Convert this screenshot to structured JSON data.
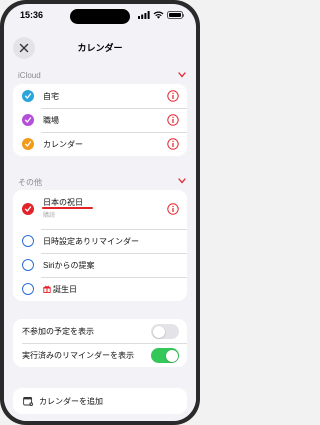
{
  "status_bar": {
    "time": "15:36",
    "icons": [
      "location-arrow-icon",
      "signal-bars-icon",
      "wifi-icon",
      "battery-icon"
    ]
  },
  "nav": {
    "close_icon": "close-icon",
    "title": "カレンダー"
  },
  "icloud_section": {
    "header": "iCloud",
    "items": [
      {
        "label": "自宅",
        "color": "#2aa5dc",
        "checked": true
      },
      {
        "label": "職場",
        "color": "#b44fd9",
        "checked": true
      },
      {
        "label": "カレンダー",
        "color": "#f29a1a",
        "checked": true
      }
    ]
  },
  "other_section": {
    "header": "その他",
    "items": [
      {
        "label": "日本の祝日",
        "sub": "購読",
        "color": "#e3232a",
        "checked": true,
        "has_info": true
      },
      {
        "label": "日時設定ありリマインダー",
        "checked": false
      },
      {
        "label": "Siriからの提案",
        "checked": false
      },
      {
        "label": "誕生日",
        "icon": "gift-icon",
        "checked": false
      }
    ]
  },
  "settings": {
    "items": [
      {
        "label": "不参加の予定を表示",
        "on": false
      },
      {
        "label": "実行済みのリマインダーを表示",
        "on": true
      }
    ]
  },
  "add_calendar": {
    "label": "カレンダーを追加",
    "icon": "calendar-add-icon"
  },
  "colors": {
    "accent": "#e3232a",
    "toggle_on": "#34c759",
    "toggle_off": "#e3e3e8",
    "empty_circle": "#2f6fd6"
  }
}
